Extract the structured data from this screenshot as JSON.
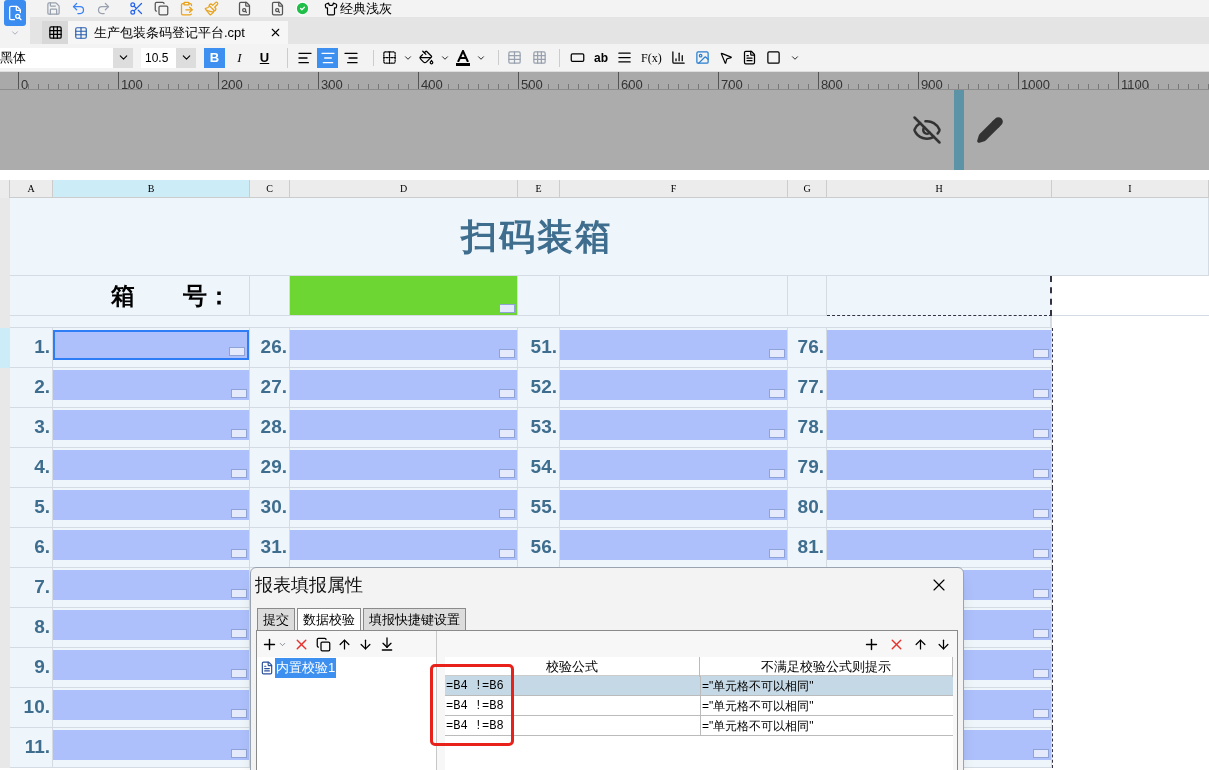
{
  "toolbar": {
    "theme_label": "经典浅灰"
  },
  "tabs": [
    {
      "label": "生产包装条码登记平台.cpt",
      "selected": true
    }
  ],
  "format_bar": {
    "font": "黑体",
    "size": "10.5",
    "style_buttons": [
      {
        "kind": "bold",
        "label": "B",
        "selected": true
      },
      {
        "kind": "italic",
        "label": "I",
        "selected": false
      },
      {
        "kind": "underline",
        "label": "U",
        "selected": false
      }
    ],
    "align_buttons": [
      {
        "kind": "left",
        "selected": false
      },
      {
        "kind": "center",
        "selected": true
      },
      {
        "kind": "right",
        "selected": false
      }
    ],
    "text_tools": [
      "ab",
      "F(x)"
    ]
  },
  "ruler": {
    "labels": [
      "0",
      "100",
      "200",
      "300",
      "400",
      "500",
      "600",
      "700",
      "800",
      "900",
      "1000",
      "1100"
    ]
  },
  "column_headers": [
    {
      "label": "A",
      "selected": false
    },
    {
      "label": "B",
      "selected": true
    },
    {
      "label": "C",
      "selected": false
    },
    {
      "label": "D",
      "selected": false
    },
    {
      "label": "E",
      "selected": false
    },
    {
      "label": "F",
      "selected": false
    },
    {
      "label": "G",
      "selected": false
    },
    {
      "label": "H",
      "selected": false
    },
    {
      "label": "I",
      "selected": false
    }
  ],
  "sheet": {
    "title": "扫码装箱",
    "box_label": "箱　　号：",
    "rows": [
      {
        "cells": [
          {
            "label": "1.",
            "selected": true
          },
          {
            "label": "26.",
            "selected": false
          },
          {
            "label": "51.",
            "selected": false
          },
          {
            "label": "76.",
            "selected": false
          }
        ]
      },
      {
        "cells": [
          {
            "label": "2.",
            "selected": false
          },
          {
            "label": "27.",
            "selected": false
          },
          {
            "label": "52.",
            "selected": false
          },
          {
            "label": "77.",
            "selected": false
          }
        ]
      },
      {
        "cells": [
          {
            "label": "3.",
            "selected": false
          },
          {
            "label": "28.",
            "selected": false
          },
          {
            "label": "53.",
            "selected": false
          },
          {
            "label": "78.",
            "selected": false
          }
        ]
      },
      {
        "cells": [
          {
            "label": "4.",
            "selected": false
          },
          {
            "label": "29.",
            "selected": false
          },
          {
            "label": "54.",
            "selected": false
          },
          {
            "label": "79.",
            "selected": false
          }
        ]
      },
      {
        "cells": [
          {
            "label": "5.",
            "selected": false
          },
          {
            "label": "30.",
            "selected": false
          },
          {
            "label": "55.",
            "selected": false
          },
          {
            "label": "80.",
            "selected": false
          }
        ]
      },
      {
        "cells": [
          {
            "label": "6.",
            "selected": false
          },
          {
            "label": "31.",
            "selected": false
          },
          {
            "label": "56.",
            "selected": false
          },
          {
            "label": "81.",
            "selected": false
          }
        ]
      },
      {
        "cells": [
          {
            "label": "7.",
            "selected": false
          }
        ]
      },
      {
        "cells": [
          {
            "label": "8.",
            "selected": false
          }
        ]
      },
      {
        "cells": [
          {
            "label": "9.",
            "selected": false
          }
        ]
      },
      {
        "cells": [
          {
            "label": "10.",
            "selected": false
          }
        ]
      },
      {
        "cells": [
          {
            "label": "11.",
            "selected": false
          }
        ]
      }
    ]
  },
  "dialog": {
    "title": "报表填报属性",
    "tabs": [
      {
        "label": "提交",
        "selected": false
      },
      {
        "label": "数据校验",
        "selected": true
      },
      {
        "label": "填报快捷键设置",
        "selected": false
      }
    ],
    "tree": [
      {
        "label": "内置校验1",
        "selected": true
      }
    ],
    "table": {
      "columns": [
        "校验公式",
        "不满足校验公式则提示"
      ],
      "rows": [
        {
          "formula": "=B4 !=B6",
          "message": "=\"单元格不可以相同\"",
          "selected": true
        },
        {
          "formula": "=B4 !=B8",
          "message": "=\"单元格不可以相同\"",
          "selected": false
        },
        {
          "formula": "=B4 !=B8",
          "message": "=\"单元格不可以相同\"",
          "selected": false
        }
      ]
    }
  }
}
